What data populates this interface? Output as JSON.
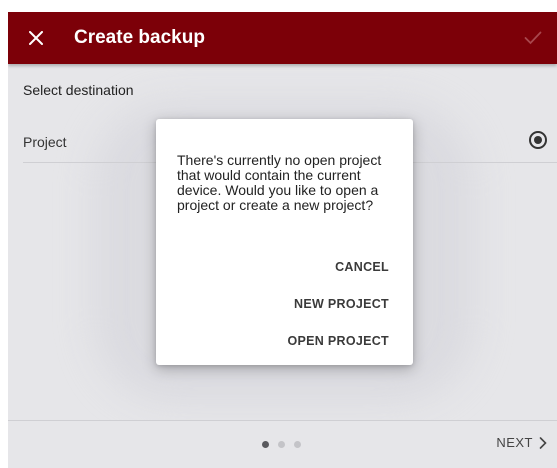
{
  "app_bar": {
    "title": "Create backup",
    "close_icon": "close-icon",
    "confirm_icon": "check-icon",
    "background": "#7c0008"
  },
  "content": {
    "section_label": "Select destination",
    "options": [
      {
        "label": "Project",
        "selected": true
      }
    ]
  },
  "footer": {
    "step_dots": 3,
    "active_step": 1,
    "next_label": "NEXT",
    "next_icon": "chevron-right-icon"
  },
  "dialog": {
    "message": "There's currently no open project that would contain the current device. Would you like to open a project or create a new project?",
    "buttons": {
      "cancel": "CANCEL",
      "new_project": "NEW PROJECT",
      "open_project": "OPEN PROJECT"
    }
  }
}
